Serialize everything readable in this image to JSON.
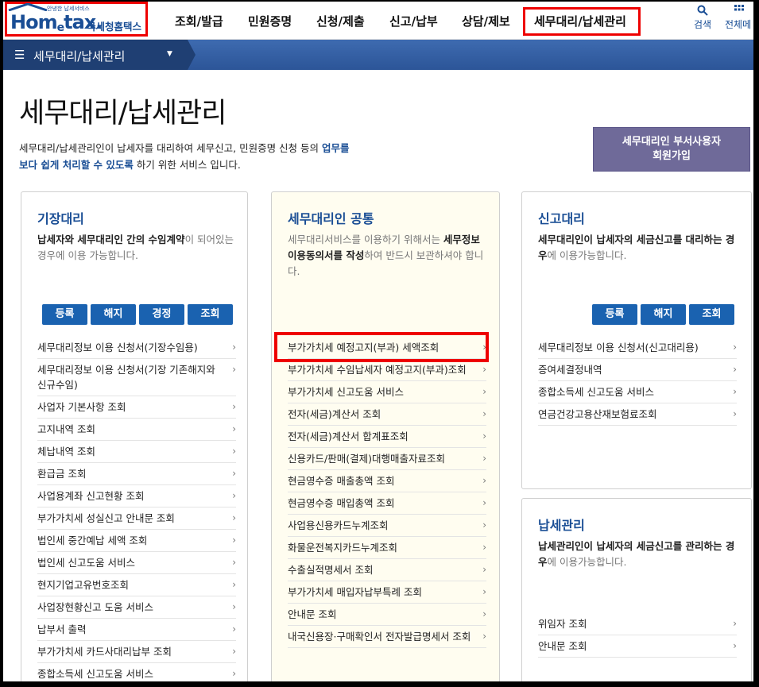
{
  "logo": {
    "small": "안녕한 납세서비스",
    "main": "Hom",
    "e": "e",
    "tax": "tax.",
    "kor": "국세청홈택스"
  },
  "nav": [
    "조회/발급",
    "민원증명",
    "신청/제출",
    "신고/납부",
    "상담/제보",
    "세무대리/납세관리"
  ],
  "nav_icons": {
    "search_label": "검색",
    "all_label": "전체메"
  },
  "breadcrumb": {
    "label": "세무대리/납세관리"
  },
  "page": {
    "title": "세무대리/납세관리",
    "desc_1": "세무대리/납세관리인이 납세자를 대리하여 세무신고, 민원증명 신청 등의 ",
    "desc_1b": "업무를",
    "desc_2b": "보다 쉽게 처리할 수 있도록",
    "desc_2": " 하기 위한 서비스 입니다.",
    "join_1": "세무대리인 부서사용자",
    "join_2": "회원가입"
  },
  "card1": {
    "title": "기장대리",
    "desc_b": "납세자와 세무대리인 간의 수임계약",
    "desc": "이 되어있는 경우에 이용 가능합니다.",
    "buttons": [
      "등록",
      "해지",
      "경정",
      "조회"
    ],
    "items": [
      "세무대리정보 이용 신청서(기장수임용)",
      "세무대리정보 이용 신청서(기장 기존해지와 신규수임)",
      "사업자 기본사항 조회",
      "고지내역 조회",
      "체납내역 조회",
      "환급금 조회",
      "사업용계좌 신고현황 조회",
      "부가가치세 성실신고 안내문 조회",
      "법인세 중간예납 세액 조회",
      "법인세 신고도움 서비스",
      "현지기업고유번호조회",
      "사업장현황신고 도움 서비스",
      "납부서 출력",
      "부가가치세 카드사대리납부 조회",
      "종합소득세 신고도움 서비스"
    ]
  },
  "card2": {
    "title": "세무대리인 공통",
    "desc_a": "세무대리서비스를 이용하기 위해서는 ",
    "desc_b": "세무정보이용동의서를 작성",
    "desc_c": "하여 반드시 보관하셔야 합니다.",
    "items": [
      "부가가치세 예정고지(부과) 세액조회",
      "부가가치세 수임납세자 예정고지(부과)조회",
      "부가가치세 신고도움 서비스",
      "전자(세금)계산서 조회",
      "전자(세금)계산서 합계표조회",
      "신용카드/판매(결제)대행매출자료조회",
      "현금영수증 매출총액 조회",
      "현금영수증 매입총액 조회",
      "사업용신용카드누계조회",
      "화물운전복지카드누계조회",
      "수출실적명세서 조회",
      "부가가치세 매입자납부특례 조회",
      "안내문 조회",
      "내국신용장·구매확인서 전자발급명세서 조회"
    ]
  },
  "card3": {
    "title": "신고대리",
    "desc_b": "세무대리인이 납세자의 세금신고를 대리하는 경우",
    "desc": "에 이용가능합니다.",
    "buttons": [
      "등록",
      "해지",
      "조회"
    ],
    "items": [
      "세무대리정보 이용 신청서(신고대리용)",
      "증여세결정내역",
      "종합소득세 신고도움 서비스",
      "연금건강고용산재보험료조회"
    ]
  },
  "card4": {
    "title": "납세관리",
    "desc_b": "납세관리인이 납세자의 세금신고를 관리하는 경우",
    "desc": "에 이용가능합니다.",
    "items": [
      "위임자 조회",
      "안내문 조회"
    ]
  },
  "colors": {
    "accent": "#1a4e95",
    "button": "#1a62b0",
    "highlight": "#ee0000",
    "join": "#6f6a99"
  }
}
